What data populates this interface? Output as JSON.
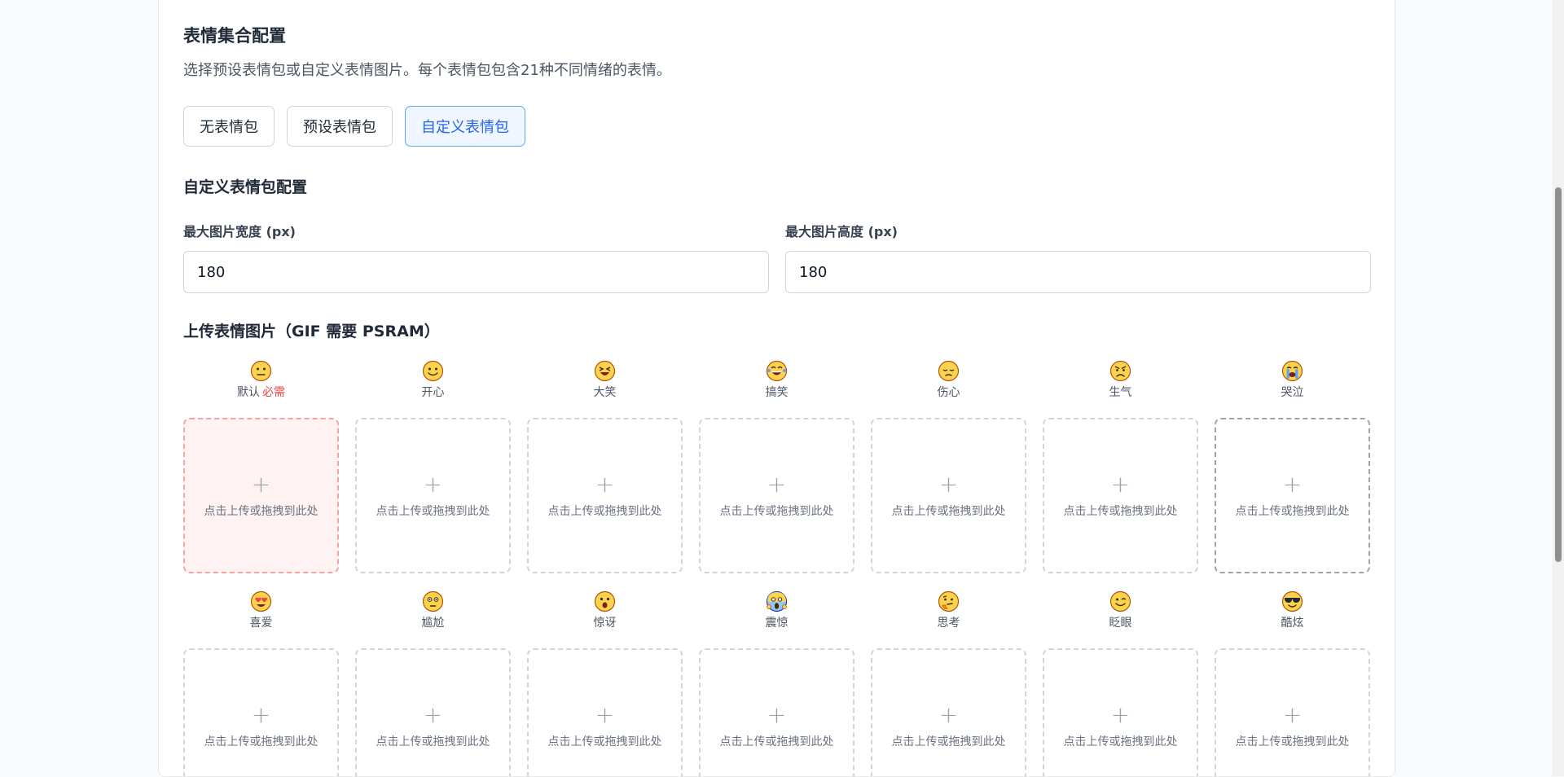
{
  "section": {
    "title": "表情集合配置",
    "description": "选择预设表情包或自定义表情图片。每个表情包包含21种不同情绪的表情。"
  },
  "modes": {
    "none": "无表情包",
    "preset": "预设表情包",
    "custom": "自定义表情包",
    "selected": "custom"
  },
  "custom_config": {
    "title": "自定义表情包配置",
    "max_width_label": "最大图片宽度 (px)",
    "max_width_value": "180",
    "max_height_label": "最大图片高度 (px)",
    "max_height_value": "180"
  },
  "upload": {
    "title": "上传表情图片（GIF 需要 PSRAM）",
    "drop_hint": "点击上传或拖拽到此处",
    "required_tag": "必需",
    "emotions": [
      {
        "label": "默认",
        "icon": "neutral-face-icon",
        "required": true
      },
      {
        "label": "开心",
        "icon": "smiling-face-icon"
      },
      {
        "label": "大笑",
        "icon": "laughing-face-icon"
      },
      {
        "label": "搞笑",
        "icon": "tears-of-joy-face-icon"
      },
      {
        "label": "伤心",
        "icon": "pensive-face-icon"
      },
      {
        "label": "生气",
        "icon": "angry-face-icon"
      },
      {
        "label": "哭泣",
        "icon": "crying-face-icon"
      },
      {
        "label": "喜爱",
        "icon": "heart-eyes-face-icon"
      },
      {
        "label": "尴尬",
        "icon": "flushed-face-icon"
      },
      {
        "label": "惊讶",
        "icon": "surprised-face-icon"
      },
      {
        "label": "震惊",
        "icon": "screaming-face-icon"
      },
      {
        "label": "思考",
        "icon": "thinking-face-icon"
      },
      {
        "label": "眨眼",
        "icon": "winking-face-icon"
      },
      {
        "label": "酷炫",
        "icon": "sunglasses-face-icon"
      }
    ]
  },
  "colors": {
    "accent": "#2563eb",
    "accent_bg": "#eff6ff",
    "required_red": "#ef4444",
    "emoji_yellow": "#fcd34d"
  }
}
